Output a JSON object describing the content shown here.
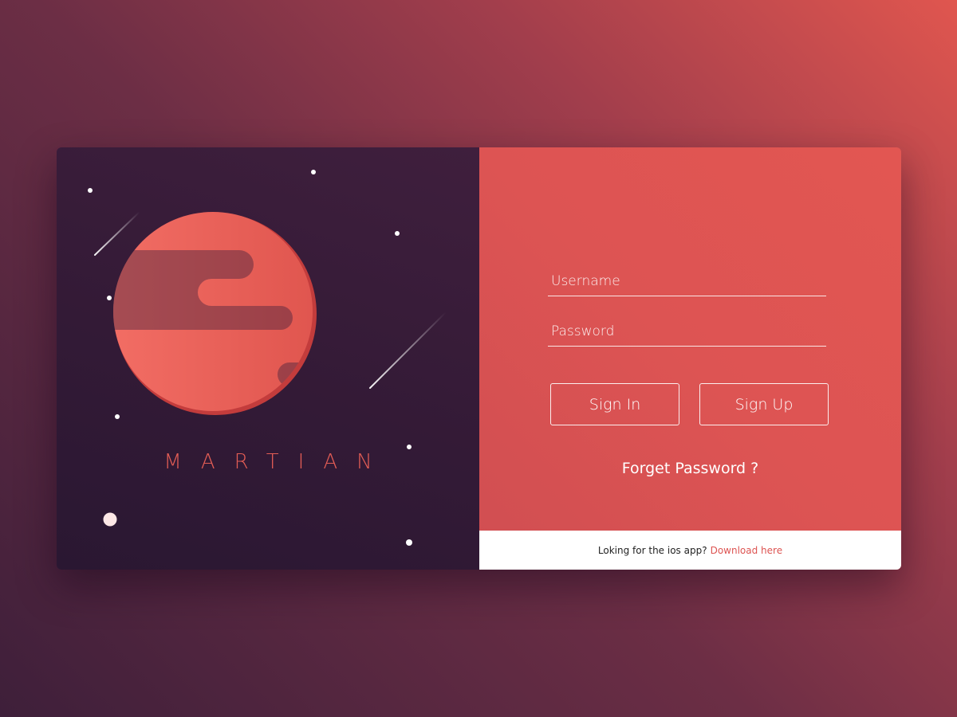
{
  "brand": {
    "name": "MARTIAN",
    "logo_icon": "planet-icon"
  },
  "form": {
    "username_placeholder": "Username",
    "username_value": "",
    "password_placeholder": "Password",
    "password_value": "",
    "sign_in_label": "Sign In",
    "sign_up_label": "Sign Up",
    "forgot_label": "Forget Password ?"
  },
  "footer": {
    "prompt": "Loking for the ios app?",
    "link_label": "Download here"
  },
  "colors": {
    "accent": "#dd5452",
    "panel_dark": "#331a36",
    "white": "#ffffff"
  }
}
